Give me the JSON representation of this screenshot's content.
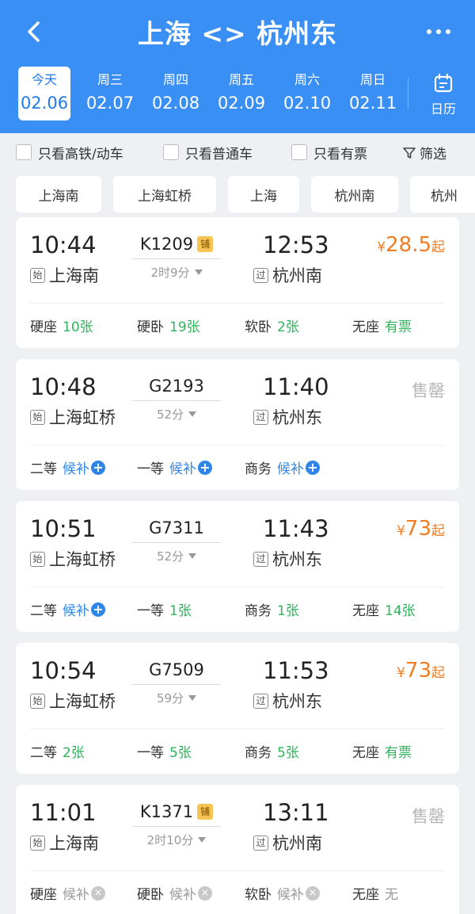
{
  "header": {
    "title": "上海 <> 杭州东",
    "back_icon": "chevron-left-icon",
    "more_icon": "more-dots-icon"
  },
  "dates": [
    {
      "week": "今天",
      "date": "02.06",
      "active": true
    },
    {
      "week": "周三",
      "date": "02.07",
      "active": false
    },
    {
      "week": "周四",
      "date": "02.08",
      "active": false
    },
    {
      "week": "周五",
      "date": "02.09",
      "active": false
    },
    {
      "week": "周六",
      "date": "02.10",
      "active": false
    },
    {
      "week": "周日",
      "date": "02.11",
      "active": false
    }
  ],
  "calendar": {
    "label": "日历",
    "icon": "calendar-icon"
  },
  "filters": {
    "high_speed": "只看高铁/动车",
    "regular": "只看普通车",
    "available": "只看有票",
    "filter": "筛选",
    "filter_icon": "funnel-icon"
  },
  "stations": [
    "上海南",
    "上海虹桥",
    "上海",
    "杭州南",
    "杭州"
  ],
  "colors": {
    "primary": "#3a8ff5",
    "price": "#f07d22",
    "available": "#2fb35b",
    "waitlist": "#2f86e8",
    "disabled": "#b5b5b5"
  },
  "trains": [
    {
      "dep_time": "10:44",
      "dep_tag": "始",
      "dep_station": "上海南",
      "train_no": "K1209",
      "sleeper_tag": "铺",
      "duration": "2时9分",
      "arr_time": "12:53",
      "arr_tag": "过",
      "arr_station": "杭州南",
      "price_currency": "¥",
      "price": "28.5",
      "price_suffix": "起",
      "sold_out": "",
      "seats": [
        {
          "name": "硬座",
          "value": "10张",
          "status": "available"
        },
        {
          "name": "硬卧",
          "value": "19张",
          "status": "available"
        },
        {
          "name": "软卧",
          "value": "2张",
          "status": "available"
        },
        {
          "name": "无座",
          "value": "有票",
          "status": "available"
        }
      ]
    },
    {
      "dep_time": "10:48",
      "dep_tag": "始",
      "dep_station": "上海虹桥",
      "train_no": "G2193",
      "sleeper_tag": "",
      "duration": "52分",
      "arr_time": "11:40",
      "arr_tag": "过",
      "arr_station": "杭州东",
      "price_currency": "",
      "price": "",
      "price_suffix": "",
      "sold_out": "售罄",
      "seats": [
        {
          "name": "二等",
          "value": "候补",
          "status": "waitlist"
        },
        {
          "name": "一等",
          "value": "候补",
          "status": "waitlist"
        },
        {
          "name": "商务",
          "value": "候补",
          "status": "waitlist"
        }
      ]
    },
    {
      "dep_time": "10:51",
      "dep_tag": "始",
      "dep_station": "上海虹桥",
      "train_no": "G7311",
      "sleeper_tag": "",
      "duration": "52分",
      "arr_time": "11:43",
      "arr_tag": "过",
      "arr_station": "杭州东",
      "price_currency": "¥",
      "price": "73",
      "price_suffix": "起",
      "sold_out": "",
      "seats": [
        {
          "name": "二等",
          "value": "候补",
          "status": "waitlist"
        },
        {
          "name": "一等",
          "value": "1张",
          "status": "available"
        },
        {
          "name": "商务",
          "value": "1张",
          "status": "available"
        },
        {
          "name": "无座",
          "value": "14张",
          "status": "available"
        }
      ]
    },
    {
      "dep_time": "10:54",
      "dep_tag": "始",
      "dep_station": "上海虹桥",
      "train_no": "G7509",
      "sleeper_tag": "",
      "duration": "59分",
      "arr_time": "11:53",
      "arr_tag": "过",
      "arr_station": "杭州东",
      "price_currency": "¥",
      "price": "73",
      "price_suffix": "起",
      "sold_out": "",
      "seats": [
        {
          "name": "二等",
          "value": "2张",
          "status": "available"
        },
        {
          "name": "一等",
          "value": "5张",
          "status": "available"
        },
        {
          "name": "商务",
          "value": "5张",
          "status": "available"
        },
        {
          "name": "无座",
          "value": "有票",
          "status": "available"
        }
      ]
    },
    {
      "dep_time": "11:01",
      "dep_tag": "始",
      "dep_station": "上海南",
      "train_no": "K1371",
      "sleeper_tag": "铺",
      "duration": "2时10分",
      "arr_time": "13:11",
      "arr_tag": "过",
      "arr_station": "杭州南",
      "price_currency": "",
      "price": "",
      "price_suffix": "",
      "sold_out": "售罄",
      "seats": [
        {
          "name": "硬座",
          "value": "候补",
          "status": "waitlist-closed"
        },
        {
          "name": "硬卧",
          "value": "候补",
          "status": "waitlist-closed"
        },
        {
          "name": "软卧",
          "value": "候补",
          "status": "waitlist-closed"
        },
        {
          "name": "无座",
          "value": "无",
          "status": "none"
        }
      ]
    }
  ]
}
